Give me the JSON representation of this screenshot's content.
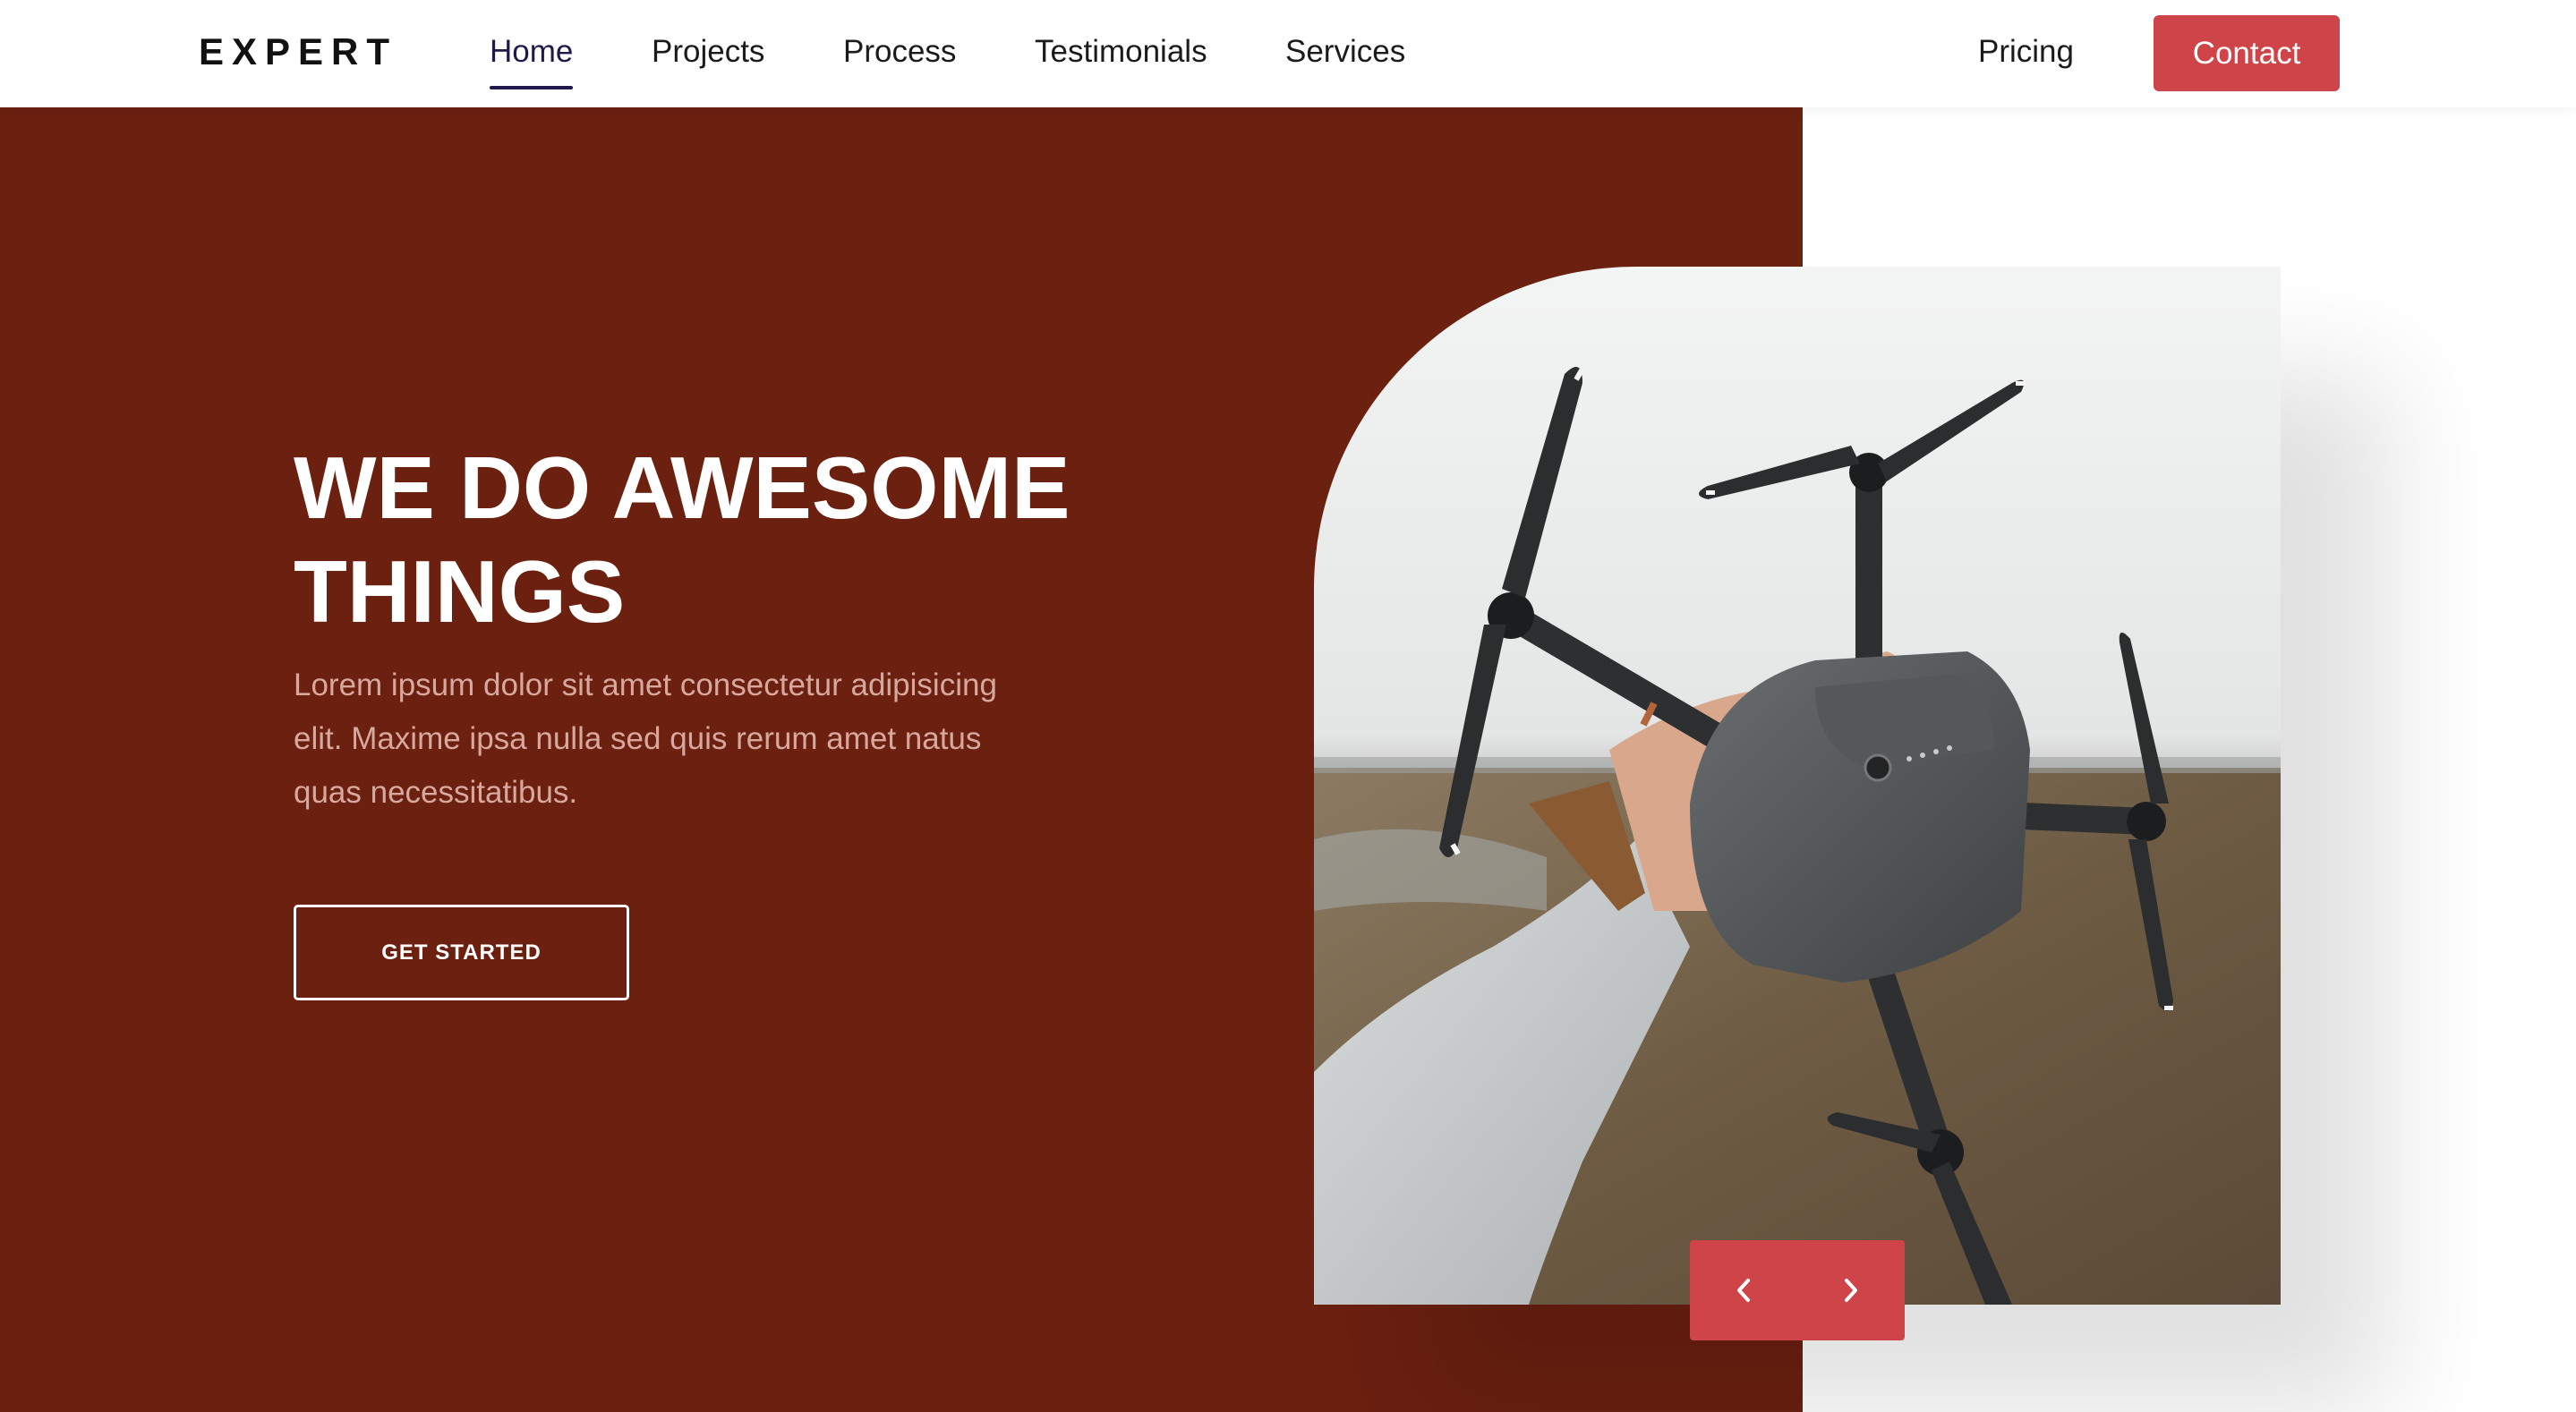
{
  "brand": {
    "logo": "EXPERT"
  },
  "nav": {
    "items": [
      {
        "label": "Home",
        "active": true
      },
      {
        "label": "Projects",
        "active": false
      },
      {
        "label": "Process",
        "active": false
      },
      {
        "label": "Testimonials",
        "active": false
      },
      {
        "label": "Services",
        "active": false
      }
    ],
    "pricing_label": "Pricing",
    "contact_label": "Contact"
  },
  "hero": {
    "title_line1": "WE DO AWESOME",
    "title_line2": "THINGS",
    "description": "Lorem ipsum dolor sit amet consectetur adipisicing elit. Maxime ipsa nulla sed quis rerum amet natus quas necessitatibus.",
    "cta_label": "GET STARTED"
  },
  "image": {
    "subject": "drone-held-in-hand-photo"
  },
  "slider": {
    "prev_icon": "chevron-left-icon",
    "next_icon": "chevron-right-icon"
  },
  "colors": {
    "hero_background": "#6b2010",
    "accent": "#cf4449",
    "nav_active": "#1f1a4a",
    "description_text": "#d8a89e"
  }
}
